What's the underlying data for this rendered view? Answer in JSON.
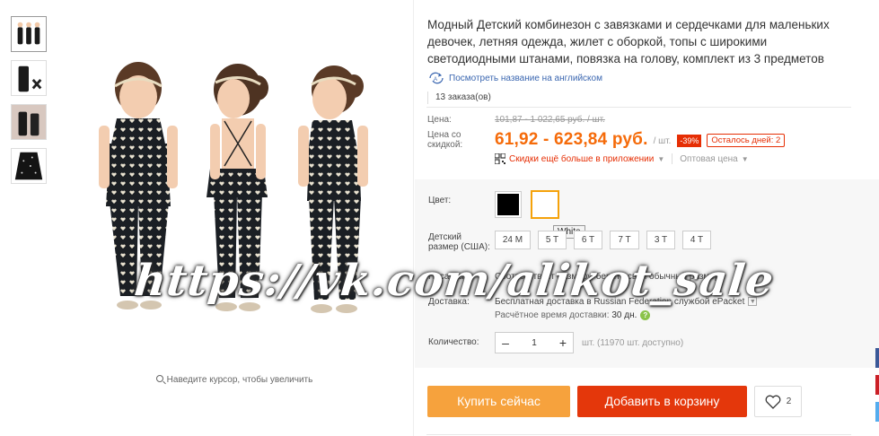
{
  "product": {
    "title": "Модный Детский комбинезон с завязками и сердечками для маленьких девочек, летняя одежда, жилет с оборкой, топы с широкими светодиодными штанами, повязка на голову, комплект из 3 предметов",
    "translate_link": "Посмотреть название на английском",
    "orders": "13 заказа(ов)"
  },
  "gallery": {
    "zoom_hint": "Наведите курсор, чтобы увеличить",
    "thumbnails": [
      "thumb-1",
      "thumb-2",
      "thumb-3",
      "thumb-4"
    ]
  },
  "price": {
    "old_label": "Цена:",
    "old_price": "101,87 - 1 022,65 руб. / шт.",
    "new_label": "Цена со скидкой:",
    "new_price": "61,92 - 623,84 руб.",
    "per_unit": "/ шт.",
    "discount": "-39%",
    "days_left": "Осталось дней: 2",
    "app_discount": "Скидки ещё больше в приложении",
    "wholesale": "Оптовая цена"
  },
  "options": {
    "color_label": "Цвет:",
    "colors": [
      "Black",
      "White"
    ],
    "tooltip": "White",
    "size_label": "Детский размер (США):",
    "sizes": [
      "24 M",
      "5 T",
      "6 T",
      "7 T",
      "3 T",
      "4 T"
    ],
    "fit_label": "Посадка:",
    "fit_text": "Соответствует размеру, берите свой обычный размер",
    "shipping_label": "Доставка:",
    "shipping_text": "Бесплатная доставка в Russian Federation службой ePacket",
    "eta_label": "Расчётное время доставки:",
    "eta_value": "30 дн.",
    "quantity_label": "Количество:",
    "quantity_value": "1",
    "availability": "шт. (11970 шт. доступно)"
  },
  "actions": {
    "buy_now": "Купить сейчас",
    "add_to_cart": "Добавить в корзину",
    "wishlist_count": "2"
  },
  "watermark": "https://vk.com/alikot_sale",
  "colors": {
    "price_orange": "#f56b0a",
    "discount_red": "#e62e04",
    "buy_now_bg": "#f6a23d",
    "add_cart_bg": "#e4370b",
    "swatch_selected": "#f5a20a"
  }
}
